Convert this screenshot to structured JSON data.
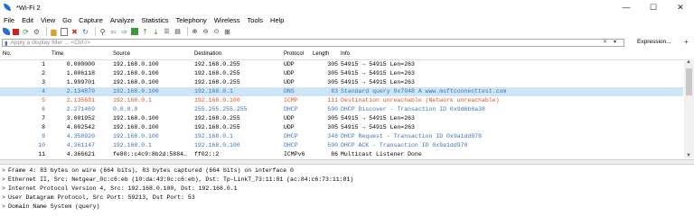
{
  "window": {
    "title": "*Wi-Fi 2",
    "controls": [
      "—",
      "☐",
      "✕"
    ]
  },
  "menu": [
    "File",
    "Edit",
    "View",
    "Go",
    "Capture",
    "Analyze",
    "Statistics",
    "Telephony",
    "Wireless",
    "Tools",
    "Help"
  ],
  "filter": {
    "placeholder": "Apply a display filter ... <Ctrl-/>",
    "expression_label": "Expression...",
    "plus_label": "+"
  },
  "columns": [
    "No.",
    "Time",
    "Source",
    "Destination",
    "Protocol",
    "Length",
    "Info"
  ],
  "packets": [
    {
      "no": "1",
      "time": "0.000000",
      "src": "192.168.0.100",
      "dst": "192.168.0.255",
      "proto": "UDP",
      "len": "305",
      "info": "54915 → 54915 Len=263",
      "color": "#000000",
      "selected": false
    },
    {
      "no": "2",
      "time": "1.006118",
      "src": "192.168.0.100",
      "dst": "192.168.0.255",
      "proto": "UDP",
      "len": "305",
      "info": "54915 → 54915 Len=263",
      "color": "#000000",
      "selected": false
    },
    {
      "no": "3",
      "time": "1.999701",
      "src": "192.168.0.100",
      "dst": "192.168.0.255",
      "proto": "UDP",
      "len": "305",
      "info": "54915 → 54915 Len=263",
      "color": "#000000",
      "selected": false
    },
    {
      "no": "4",
      "time": "2.134870",
      "src": "192.168.0.100",
      "dst": "192.168.0.1",
      "proto": "DNS",
      "len": "83",
      "info": "Standard query 0x7948 A www.msftconnecttest.com",
      "color": "#3b73b9",
      "selected": true
    },
    {
      "no": "5",
      "time": "2.135681",
      "src": "192.168.0.1",
      "dst": "192.168.0.100",
      "proto": "ICMP",
      "len": "111",
      "info": "Destination unreachable (Network unreachable)",
      "color": "#e5531a",
      "selected": false
    },
    {
      "no": "6",
      "time": "2.271469",
      "src": "0.0.0.0",
      "dst": "255.255.255.255",
      "proto": "DHCP",
      "len": "590",
      "info": "DHCP Discover - Transaction ID 0x9d6b6a38",
      "color": "#3b73b9",
      "selected": false
    },
    {
      "no": "7",
      "time": "3.001952",
      "src": "192.168.0.100",
      "dst": "192.168.0.255",
      "proto": "UDP",
      "len": "305",
      "info": "54915 → 54915 Len=263",
      "color": "#000000",
      "selected": false
    },
    {
      "no": "8",
      "time": "4.002542",
      "src": "192.168.0.100",
      "dst": "192.168.0.255",
      "proto": "UDP",
      "len": "305",
      "info": "54915 → 54915 Len=263",
      "color": "#000000",
      "selected": false
    },
    {
      "no": "9",
      "time": "4.358920",
      "src": "192.168.0.100",
      "dst": "192.168.0.1",
      "proto": "DHCP",
      "len": "348",
      "info": "DHCP Request  - Transaction ID 0x9a1dd978",
      "color": "#3b73b9",
      "selected": false
    },
    {
      "no": "10",
      "time": "4.361147",
      "src": "192.168.0.1",
      "dst": "192.168.0.100",
      "proto": "DHCP",
      "len": "590",
      "info": "DHCP ACK      - Transaction ID 0x9a1dd978",
      "color": "#3b73b9",
      "selected": false
    },
    {
      "no": "11",
      "time": "4.366621",
      "src": "fe80::c4c9:8b2d:5884…",
      "dst": "ff02::2",
      "proto": "ICMPv6",
      "len": "86",
      "info": "Multicast Listener Done",
      "color": "#000000",
      "selected": false
    }
  ],
  "details": [
    "Frame 4: 83 bytes on wire (664 bits), 83 bytes captured (664 bits) on interface 0",
    "Ethernet II, Src: Netgear_0c:c6:eb (10:da:43:0c:c6:eb), Dst: Tp-LinkT_73:11:81 (ac:84:c6:73:11:81)",
    "Internet Protocol Version 4, Src: 192.168.0.100, Dst: 192.168.0.1",
    "User Datagram Protocol, Src Port: 59213, Dst Port: 53",
    "Domain Name System (query)"
  ],
  "detail_expander": ">",
  "icons": {
    "shark_fin": "shark-fin-icon",
    "stop": "stop-icon",
    "restart": "restart-icon",
    "options": "gear-icon",
    "open": "folder-icon",
    "save": "save-icon",
    "close": "close-icon",
    "reload": "reload-icon",
    "find": "search-icon",
    "back": "back-arrow-icon",
    "forward": "forward-arrow-icon",
    "goto": "goto-packet-icon",
    "first": "first-packet-icon",
    "last": "last-packet-icon",
    "autoscroll": "autoscroll-icon",
    "colorize": "colorize-icon",
    "zoom_in": "zoom-in-icon",
    "zoom_out": "zoom-out-icon",
    "zoom_normal": "zoom-normal-icon",
    "resize": "resize-columns-icon"
  },
  "colors": {
    "selected_row": "#cde6f7",
    "dns_dhcp_text": "#3b73b9",
    "icmp_text": "#e5531a"
  }
}
